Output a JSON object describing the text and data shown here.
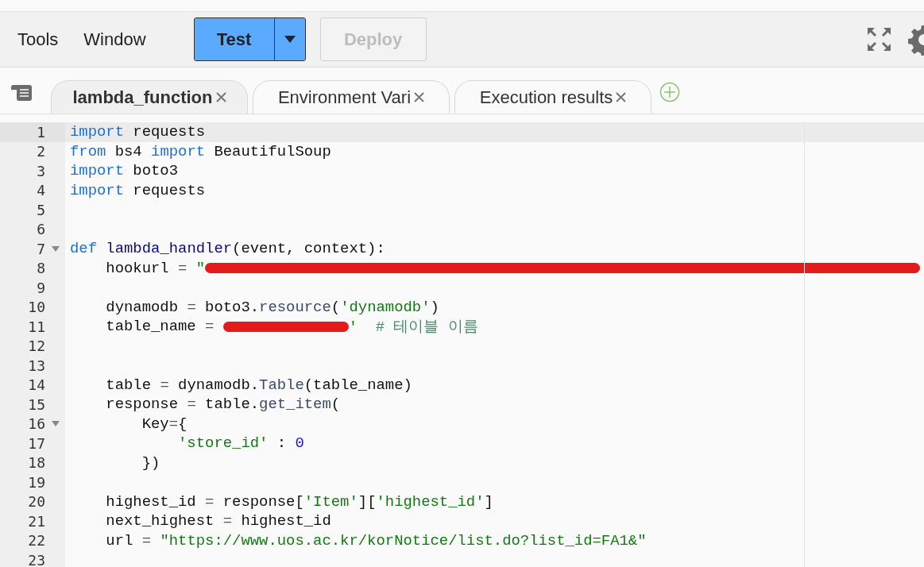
{
  "menu": [
    {
      "label": "Tools"
    },
    {
      "label": "Window"
    }
  ],
  "toolbar": {
    "test_button": "Test",
    "deploy_button": {
      "label": "Deploy",
      "disabled": true
    }
  },
  "tabs": [
    {
      "label": "lambda_function",
      "selected": true
    },
    {
      "label": "Environment Vari",
      "selected": false
    },
    {
      "label": "Execution results",
      "selected": false
    }
  ],
  "editor": {
    "lines": [
      {
        "number": "1",
        "active": true,
        "fold": false,
        "tokens": [
          {
            "kind": "kw",
            "text": "import "
          },
          {
            "kind": "plain",
            "text": "requests"
          }
        ]
      },
      {
        "number": "2",
        "active": false,
        "fold": false,
        "tokens": [
          {
            "kind": "kw",
            "text": "from "
          },
          {
            "kind": "plain",
            "text": "bs4 "
          },
          {
            "kind": "kw",
            "text": "import "
          },
          {
            "kind": "plain",
            "text": "BeautifulSoup"
          }
        ]
      },
      {
        "number": "3",
        "active": false,
        "fold": false,
        "tokens": [
          {
            "kind": "kw",
            "text": "import "
          },
          {
            "kind": "plain",
            "text": "boto3"
          }
        ]
      },
      {
        "number": "4",
        "active": false,
        "fold": false,
        "tokens": [
          {
            "kind": "kw",
            "text": "import "
          },
          {
            "kind": "plain",
            "text": "requests"
          }
        ]
      },
      {
        "number": "5",
        "active": false,
        "fold": false
      },
      {
        "number": "6",
        "active": false,
        "fold": false
      },
      {
        "number": "7",
        "active": false,
        "fold": true,
        "tokens": [
          {
            "kind": "kw",
            "text": "def "
          },
          {
            "kind": "def",
            "text": "lambda_handler"
          },
          {
            "kind": "plain",
            "text": "(event, context):"
          }
        ]
      },
      {
        "number": "8",
        "active": false,
        "fold": false,
        "tokens": [
          {
            "kind": "plain",
            "text": "    hookurl "
          },
          {
            "kind": "op",
            "text": "= "
          },
          {
            "kind": "str",
            "text": "\""
          },
          {
            "kind": "redacted"
          }
        ]
      },
      {
        "number": "9",
        "active": false,
        "fold": false
      },
      {
        "number": "10",
        "active": false,
        "fold": false,
        "tokens": [
          {
            "kind": "plain",
            "text": "    dynamodb "
          },
          {
            "kind": "op",
            "text": "= "
          },
          {
            "kind": "plain",
            "text": "boto3."
          },
          {
            "kind": "fn",
            "text": "resource"
          },
          {
            "kind": "plain",
            "text": "("
          },
          {
            "kind": "str",
            "text": "'dynamodb'"
          },
          {
            "kind": "plain",
            "text": ")"
          }
        ]
      },
      {
        "number": "11",
        "active": false,
        "fold": false,
        "tokens": [
          {
            "kind": "plain",
            "text": "    table_name "
          },
          {
            "kind": "op",
            "text": "= "
          },
          {
            "kind": "redacted"
          },
          {
            "kind": "str",
            "text": "'"
          },
          {
            "kind": "comment",
            "text": "  # 테이블 이름"
          }
        ]
      },
      {
        "number": "12",
        "active": false,
        "fold": false
      },
      {
        "number": "13",
        "active": false,
        "fold": false
      },
      {
        "number": "14",
        "active": false,
        "fold": false,
        "tokens": [
          {
            "kind": "plain",
            "text": "    table "
          },
          {
            "kind": "op",
            "text": "= "
          },
          {
            "kind": "plain",
            "text": "dynamodb."
          },
          {
            "kind": "fn",
            "text": "Table"
          },
          {
            "kind": "plain",
            "text": "(table_name)"
          }
        ]
      },
      {
        "number": "15",
        "active": false,
        "fold": false,
        "tokens": [
          {
            "kind": "plain",
            "text": "    response "
          },
          {
            "kind": "op",
            "text": "= "
          },
          {
            "kind": "plain",
            "text": "table."
          },
          {
            "kind": "fn",
            "text": "get_item"
          },
          {
            "kind": "plain",
            "text": "("
          }
        ]
      },
      {
        "number": "16",
        "active": false,
        "fold": true,
        "tokens": [
          {
            "kind": "plain",
            "text": "        Key"
          },
          {
            "kind": "op",
            "text": "="
          },
          {
            "kind": "plain",
            "text": "{"
          }
        ]
      },
      {
        "number": "17",
        "active": false,
        "fold": false,
        "tokens": [
          {
            "kind": "str",
            "text": "            'store_id'"
          },
          {
            "kind": "plain",
            "text": " : "
          },
          {
            "kind": "num",
            "text": "0"
          }
        ]
      },
      {
        "number": "18",
        "active": false,
        "fold": false,
        "tokens": [
          {
            "kind": "plain",
            "text": "        })"
          }
        ]
      },
      {
        "number": "19",
        "active": false,
        "fold": false
      },
      {
        "number": "20",
        "active": false,
        "fold": false,
        "tokens": [
          {
            "kind": "plain",
            "text": "    highest_id "
          },
          {
            "kind": "op",
            "text": "= "
          },
          {
            "kind": "plain",
            "text": "response["
          },
          {
            "kind": "str",
            "text": "'Item'"
          },
          {
            "kind": "plain",
            "text": "]["
          },
          {
            "kind": "str",
            "text": "'highest_id'"
          },
          {
            "kind": "plain",
            "text": "]"
          }
        ]
      },
      {
        "number": "21",
        "active": false,
        "fold": false,
        "tokens": [
          {
            "kind": "plain",
            "text": "    next_highest "
          },
          {
            "kind": "op",
            "text": "= "
          },
          {
            "kind": "plain",
            "text": "highest_id"
          }
        ]
      },
      {
        "number": "22",
        "active": false,
        "fold": false,
        "tokens": [
          {
            "kind": "plain",
            "text": "    url "
          },
          {
            "kind": "op",
            "text": "= "
          },
          {
            "kind": "str",
            "text": "\"https://www.uos.ac.kr/korNotice/list.do?list_id=FA1&\""
          }
        ]
      },
      {
        "number": "23",
        "active": false,
        "fold": false
      }
    ]
  }
}
